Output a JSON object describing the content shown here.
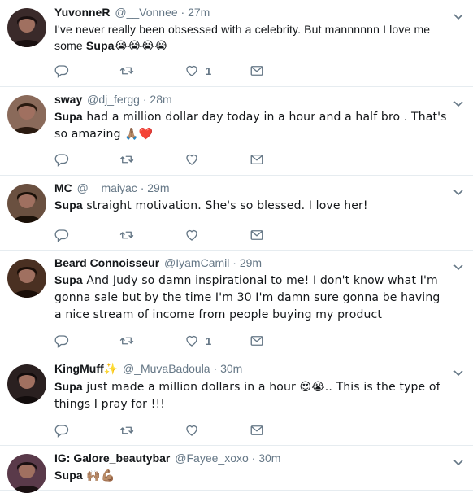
{
  "tweets": [
    {
      "name": "YuvonneR",
      "badge": "",
      "handle": "@__Vonnee",
      "time": "27m",
      "mention": "Supa",
      "text_before": "I've never really been obsessed with a celebrity. But mannnnnn I love me some ",
      "text_after": "😭😭😭😭",
      "likes": "1",
      "avatar_color": "#3a2a2a"
    },
    {
      "name": "sway",
      "badge": "",
      "handle": "@dj_fergg",
      "time": "28m",
      "mention": "Supa",
      "text_before": "",
      "text_after": " had a million dollar day today in a hour and a half bro . That's so amazing 🙏🏽❤️",
      "likes": "",
      "avatar_color": "#8a6a5a"
    },
    {
      "name": "MC",
      "badge": "",
      "handle": "@__maiyac",
      "time": "29m",
      "mention": "Supa",
      "text_before": "",
      "text_after": " straight motivation. She's so blessed. I love her!",
      "likes": "",
      "avatar_color": "#6a5040"
    },
    {
      "name": "Beard Connoisseur",
      "badge": "",
      "handle": "@IyamCamil",
      "time": "29m",
      "mention": "Supa",
      "text_before": "",
      "text_after": " And Judy so damn inspirational to me! I don't know what I'm gonna sale but by the time I'm 30 I'm damn sure gonna be having a nice stream of income from people buying my product",
      "likes": "1",
      "avatar_color": "#4a3022"
    },
    {
      "name": "KingMuff",
      "badge": "✨",
      "handle": "@_MuvaBadoula",
      "time": "30m",
      "mention": "Supa",
      "text_before": "",
      "text_after": " just made a million dollars in a hour 😍😭.. This is the type of things I pray for !!!",
      "likes": "",
      "avatar_color": "#2a2020"
    },
    {
      "name": "IG: Galore_beautybar",
      "badge": "",
      "handle": "@Fayee_xoxo",
      "time": "30m",
      "mention": "Supa",
      "text_before": "",
      "text_after": " 🙌🏽💪🏽",
      "likes": "",
      "avatar_color": "#5a3a4a"
    }
  ],
  "separator": "·",
  "icons": {
    "reply": "reply-icon",
    "retweet": "retweet-icon",
    "like": "heart-icon",
    "dm": "envelope-icon",
    "more": "chevron-down-icon"
  },
  "colors": {
    "icon_gray": "#657786",
    "text": "#14171a",
    "border": "#e6ecf0"
  }
}
